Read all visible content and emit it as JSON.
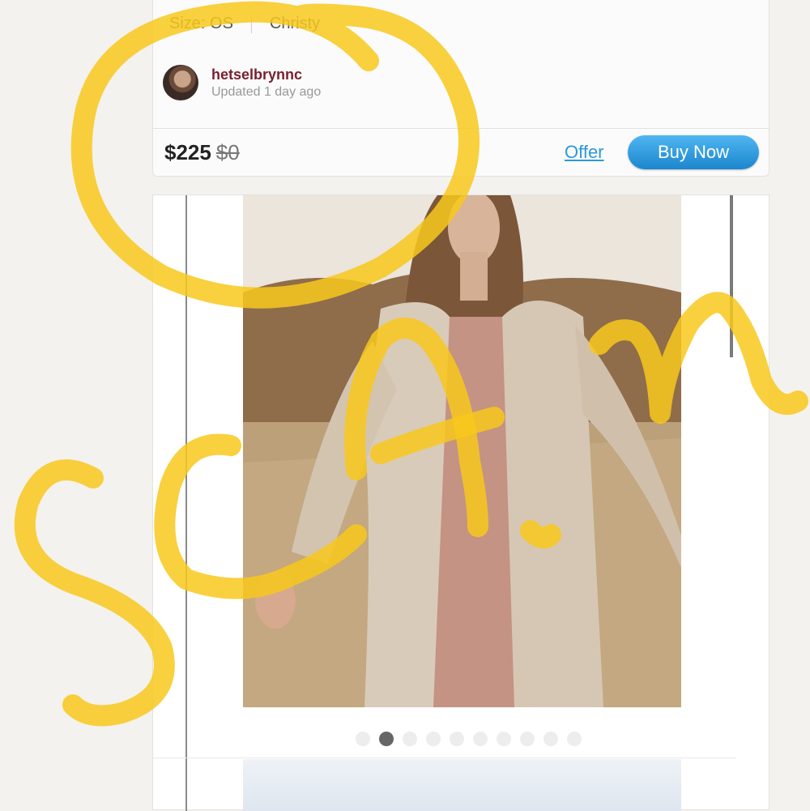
{
  "listing": {
    "size": "Size: OS",
    "brand": "Christy",
    "seller_name": "hetselbrynnc",
    "updated": "Updated 1 day ago",
    "price": "$225",
    "original_price": "$0",
    "offer_label": "Offer",
    "buy_label": "Buy Now"
  },
  "gallery": {
    "dot_count": 10,
    "active_dot": 1
  },
  "annotation": {
    "text": "SCAM",
    "color": "#f8c81c"
  }
}
